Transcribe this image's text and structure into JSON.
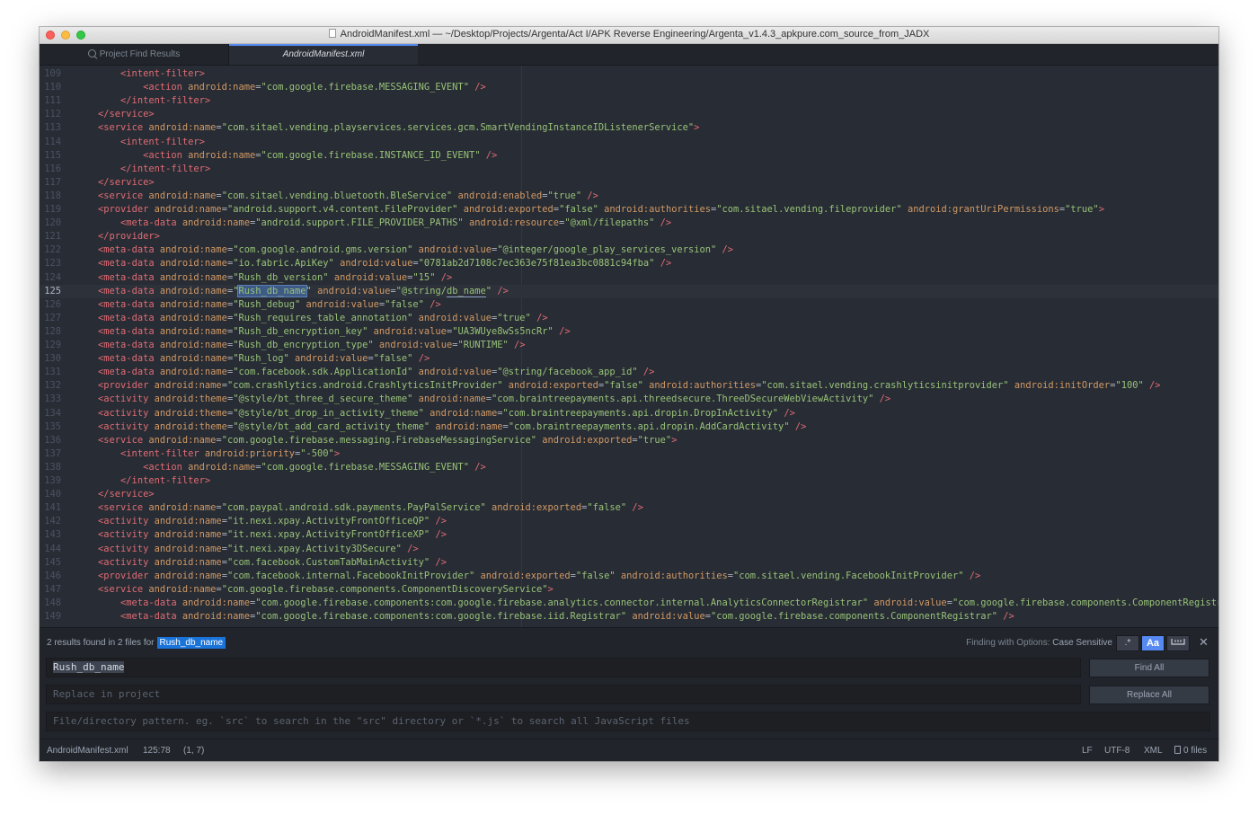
{
  "window": {
    "title": "AndroidManifest.xml — ~/Desktop/Projects/Argenta/Act I/APK Reverse Engineering/Argenta_v1.4.3_apkpure.com_source_from_JADX"
  },
  "tabs": [
    {
      "label": "Project Find Results",
      "icon": "search-icon",
      "active": false
    },
    {
      "label": "AndroidManifest.xml",
      "active": true
    }
  ],
  "editor": {
    "current_line": 125,
    "lines": [
      {
        "num": "109",
        "indent": "        ",
        "code": "<intent-filter>"
      },
      {
        "num": "110",
        "indent": "            ",
        "code": "<action android:name=\"com.google.firebase.MESSAGING_EVENT\" />"
      },
      {
        "num": "111",
        "indent": "        ",
        "code": "</intent-filter>"
      },
      {
        "num": "112",
        "indent": "    ",
        "code": "</service>"
      },
      {
        "num": "113",
        "indent": "    ",
        "code": "<service android:name=\"com.sitael.vending.playservices.services.gcm.SmartVendingInstanceIDListenerService\">"
      },
      {
        "num": "114",
        "indent": "        ",
        "code": "<intent-filter>"
      },
      {
        "num": "115",
        "indent": "            ",
        "code": "<action android:name=\"com.google.firebase.INSTANCE_ID_EVENT\" />"
      },
      {
        "num": "116",
        "indent": "        ",
        "code": "</intent-filter>"
      },
      {
        "num": "117",
        "indent": "    ",
        "code": "</service>"
      },
      {
        "num": "118",
        "indent": "    ",
        "code": "<service android:name=\"com.sitael.vending.bluetooth.BleService\" android:enabled=\"true\" />"
      },
      {
        "num": "119",
        "indent": "    ",
        "code": "<provider android:name=\"android.support.v4.content.FileProvider\" android:exported=\"false\" android:authorities=\"com.sitael.vending.fileprovider\" android:grantUriPermissions=\"true\">"
      },
      {
        "num": "120",
        "indent": "        ",
        "code": "<meta-data android:name=\"android.support.FILE_PROVIDER_PATHS\" android:resource=\"@xml/filepaths\" />"
      },
      {
        "num": "121",
        "indent": "    ",
        "code": "</provider>"
      },
      {
        "num": "122",
        "indent": "    ",
        "code": "<meta-data android:name=\"com.google.android.gms.version\" android:value=\"@integer/google_play_services_version\" />"
      },
      {
        "num": "123",
        "indent": "    ",
        "code": "<meta-data android:name=\"io.fabric.ApiKey\" android:value=\"0781ab2d7108c7ec363e75f81ea3bc0881c94fba\" />"
      },
      {
        "num": "124",
        "indent": "    ",
        "code": "<meta-data android:name=\"Rush_db_version\" android:value=\"15\" />"
      },
      {
        "num": "125",
        "indent": "    ",
        "code": "<meta-data android:name=\"Rush_db_name\" android:value=\"@string/db_name\" />"
      },
      {
        "num": "126",
        "indent": "    ",
        "code": "<meta-data android:name=\"Rush_debug\" android:value=\"false\" />"
      },
      {
        "num": "127",
        "indent": "    ",
        "code": "<meta-data android:name=\"Rush_requires_table_annotation\" android:value=\"true\" />"
      },
      {
        "num": "128",
        "indent": "    ",
        "code": "<meta-data android:name=\"Rush_db_encryption_key\" android:value=\"UA3WUye8wSs5ncRr\" />"
      },
      {
        "num": "129",
        "indent": "    ",
        "code": "<meta-data android:name=\"Rush_db_encryption_type\" android:value=\"RUNTIME\" />"
      },
      {
        "num": "130",
        "indent": "    ",
        "code": "<meta-data android:name=\"Rush_log\" android:value=\"false\" />"
      },
      {
        "num": "131",
        "indent": "    ",
        "code": "<meta-data android:name=\"com.facebook.sdk.ApplicationId\" android:value=\"@string/facebook_app_id\" />"
      },
      {
        "num": "132",
        "indent": "    ",
        "code": "<provider android:name=\"com.crashlytics.android.CrashlyticsInitProvider\" android:exported=\"false\" android:authorities=\"com.sitael.vending.crashlyticsinitprovider\" android:initOrder=\"100\" />"
      },
      {
        "num": "133",
        "indent": "    ",
        "code": "<activity android:theme=\"@style/bt_three_d_secure_theme\" android:name=\"com.braintreepayments.api.threedsecure.ThreeDSecureWebViewActivity\" />"
      },
      {
        "num": "134",
        "indent": "    ",
        "code": "<activity android:theme=\"@style/bt_drop_in_activity_theme\" android:name=\"com.braintreepayments.api.dropin.DropInActivity\" />"
      },
      {
        "num": "135",
        "indent": "    ",
        "code": "<activity android:theme=\"@style/bt_add_card_activity_theme\" android:name=\"com.braintreepayments.api.dropin.AddCardActivity\" />"
      },
      {
        "num": "136",
        "indent": "    ",
        "code": "<service android:name=\"com.google.firebase.messaging.FirebaseMessagingService\" android:exported=\"true\">"
      },
      {
        "num": "137",
        "indent": "        ",
        "code": "<intent-filter android:priority=\"-500\">"
      },
      {
        "num": "138",
        "indent": "            ",
        "code": "<action android:name=\"com.google.firebase.MESSAGING_EVENT\" />"
      },
      {
        "num": "139",
        "indent": "        ",
        "code": "</intent-filter>"
      },
      {
        "num": "140",
        "indent": "    ",
        "code": "</service>"
      },
      {
        "num": "141",
        "indent": "    ",
        "code": "<service android:name=\"com.paypal.android.sdk.payments.PayPalService\" android:exported=\"false\" />"
      },
      {
        "num": "142",
        "indent": "    ",
        "code": "<activity android:name=\"it.nexi.xpay.ActivityFrontOfficeQP\" />"
      },
      {
        "num": "143",
        "indent": "    ",
        "code": "<activity android:name=\"it.nexi.xpay.ActivityFrontOfficeXP\" />"
      },
      {
        "num": "144",
        "indent": "    ",
        "code": "<activity android:name=\"it.nexi.xpay.Activity3DSecure\" />"
      },
      {
        "num": "145",
        "indent": "    ",
        "code": "<activity android:name=\"com.facebook.CustomTabMainActivity\" />"
      },
      {
        "num": "146",
        "indent": "    ",
        "code": "<provider android:name=\"com.facebook.internal.FacebookInitProvider\" android:exported=\"false\" android:authorities=\"com.sitael.vending.FacebookInitProvider\" />"
      },
      {
        "num": "147",
        "indent": "    ",
        "code": "<service android:name=\"com.google.firebase.components.ComponentDiscoveryService\">"
      },
      {
        "num": "148",
        "indent": "        ",
        "code": "<meta-data android:name=\"com.google.firebase.components:com.google.firebase.analytics.connector.internal.AnalyticsConnectorRegistrar\" android:value=\"com.google.firebase.components.ComponentRegistrar\" />"
      },
      {
        "num": "149",
        "indent": "        ",
        "code": "<meta-data android:name=\"com.google.firebase.components:com.google.firebase.iid.Registrar\" android:value=\"com.google.firebase.components.ComponentRegistrar\" />"
      }
    ]
  },
  "find": {
    "summary_prefix": "2 results found in 2 files for",
    "query_tag": "Rush_db_name",
    "options_label": "Finding with Options:",
    "options_value": "Case Sensitive",
    "regex_toggle": ".*",
    "case_toggle": "Aa",
    "whole_word_icon": "whole-word-icon",
    "search_value": "Rush_db_name",
    "replace_placeholder": "Replace in project",
    "pattern_placeholder": "File/directory pattern. eg. `src` to search in the \"src\" directory or `*.js` to search all JavaScript files",
    "find_all": "Find All",
    "replace_all": "Replace All",
    "close_icon": "close-icon"
  },
  "status": {
    "file": "AndroidManifest.xml",
    "cursor": "125:78",
    "selection": "(1, 7)",
    "line_ending": "LF",
    "encoding": "UTF-8",
    "grammar": "XML",
    "files": "0 files"
  },
  "colors": {
    "background": "#282c34",
    "tag": "#e06c75",
    "attribute": "#d19a66",
    "string": "#98c379",
    "accent": "#568af2"
  }
}
